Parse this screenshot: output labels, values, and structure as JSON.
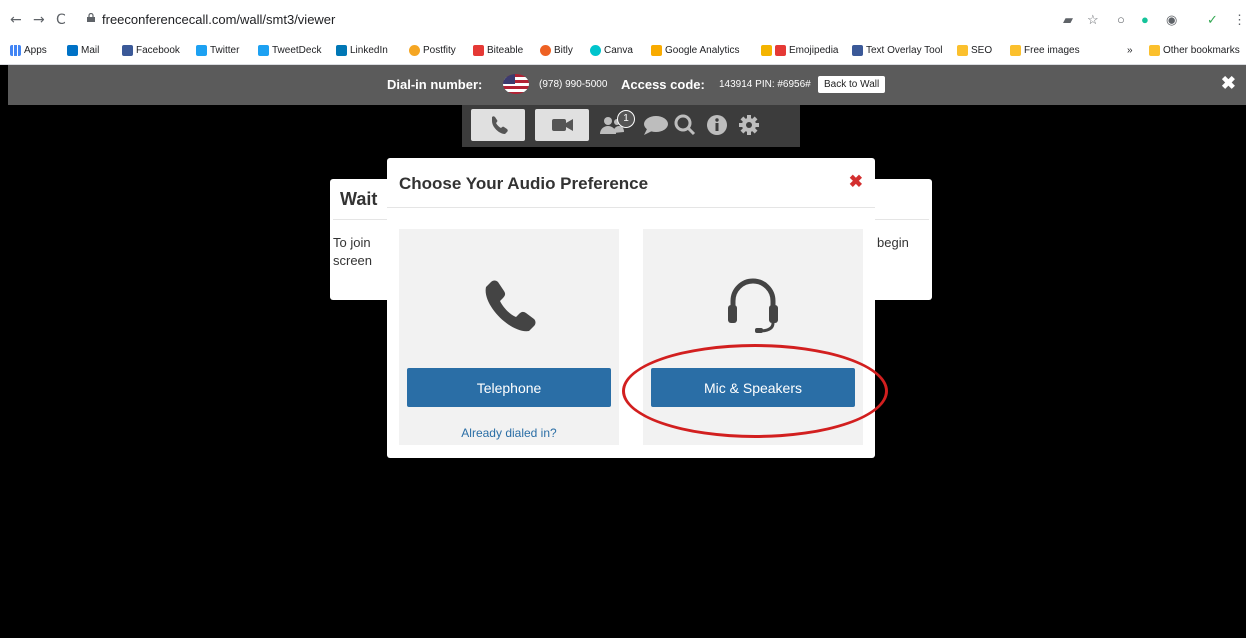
{
  "browser": {
    "url": "freeconferencecall.com/wall/smt3/viewer",
    "bookmarks": [
      "Apps",
      "Mail",
      "Facebook",
      "Twitter",
      "TweetDeck",
      "LinkedIn",
      "Postfity",
      "Biteable",
      "Bitly",
      "Canva",
      "Google Analytics",
      "Emojipedia",
      "Text Overlay Tool",
      "SEO",
      "Free images"
    ],
    "overflow": "»",
    "other_bookmarks": "Other bookmarks"
  },
  "dial_bar": {
    "dial_in_label": "Dial-in number:",
    "dial_in_number": "(978) 990-5000",
    "access_label": "Access code:",
    "access_code": "143914 PIN: #6956#",
    "back_to_wall": "Back to Wall"
  },
  "toolbar": {
    "participants_badge": "1"
  },
  "wait_panel": {
    "title": "Wait",
    "line1_left": "To join",
    "line2_left": "screen",
    "line1_right": "begin"
  },
  "modal": {
    "title": "Choose Your Audio Preference",
    "telephone_button": "Telephone",
    "already_dialed_link": "Already dialed in?",
    "mic_button": "Mic & Speakers"
  },
  "colors": {
    "primary_button": "#2a6ea6",
    "close_red": "#d32f2f",
    "annotation_circle": "#d21f1f"
  }
}
